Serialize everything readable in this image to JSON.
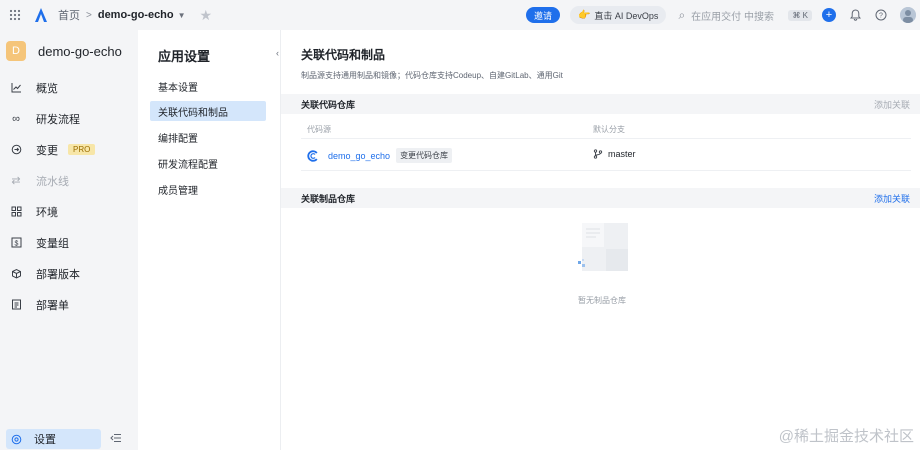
{
  "topbar": {
    "breadcrumb_home": "首页",
    "breadcrumb_sep": ">",
    "project": "demo-go-echo",
    "invite_label": "邀请",
    "ai_label": "直击 AI DevOps",
    "search_placeholder": "在应用交付 中搜索",
    "shortcut": "⌘ K"
  },
  "sidebar": {
    "project_initial": "D",
    "project_name": "demo-go-echo",
    "items": [
      {
        "label": "概览",
        "icon": "chart-line-icon",
        "disabled": false
      },
      {
        "label": "研发流程",
        "icon": "infinity-icon",
        "disabled": false
      },
      {
        "label": "变更",
        "icon": "change-icon",
        "badge": "PRO",
        "disabled": false
      },
      {
        "label": "流水线",
        "icon": "pipeline-icon",
        "disabled": true
      },
      {
        "label": "环境",
        "icon": "grid-icon",
        "disabled": false
      },
      {
        "label": "变量组",
        "icon": "variable-icon",
        "disabled": false
      },
      {
        "label": "部署版本",
        "icon": "package-icon",
        "disabled": false
      },
      {
        "label": "部署单",
        "icon": "document-icon",
        "disabled": false
      }
    ],
    "settings_label": "设置"
  },
  "settings_menu": {
    "title": "应用设置",
    "items": [
      "基本设置",
      "关联代码和制品",
      "编排配置",
      "研发流程配置",
      "成员管理"
    ],
    "active_index": 1
  },
  "main": {
    "title": "关联代码和制品",
    "description": "制品源支持通用制品和镜像；代码仓库支持Codeup、自建GitLab、通用Git",
    "code_section": {
      "title": "关联代码仓库",
      "action": "添加关联",
      "col_source": "代码源",
      "col_branch": "默认分支",
      "repo_name": "demo_go_echo",
      "change_label": "变更代码仓库",
      "branch": "master"
    },
    "artifact_section": {
      "title": "关联制品仓库",
      "action": "添加关联",
      "empty_text": "暂无制品仓库"
    }
  },
  "watermark": "@稀土掘金技术社区",
  "colors": {
    "accent": "#1f6feb",
    "active_bg": "#d4e6fb",
    "sidebar_bg": "#f4f5f7",
    "pro_badge_bg": "#f7e6a8"
  }
}
